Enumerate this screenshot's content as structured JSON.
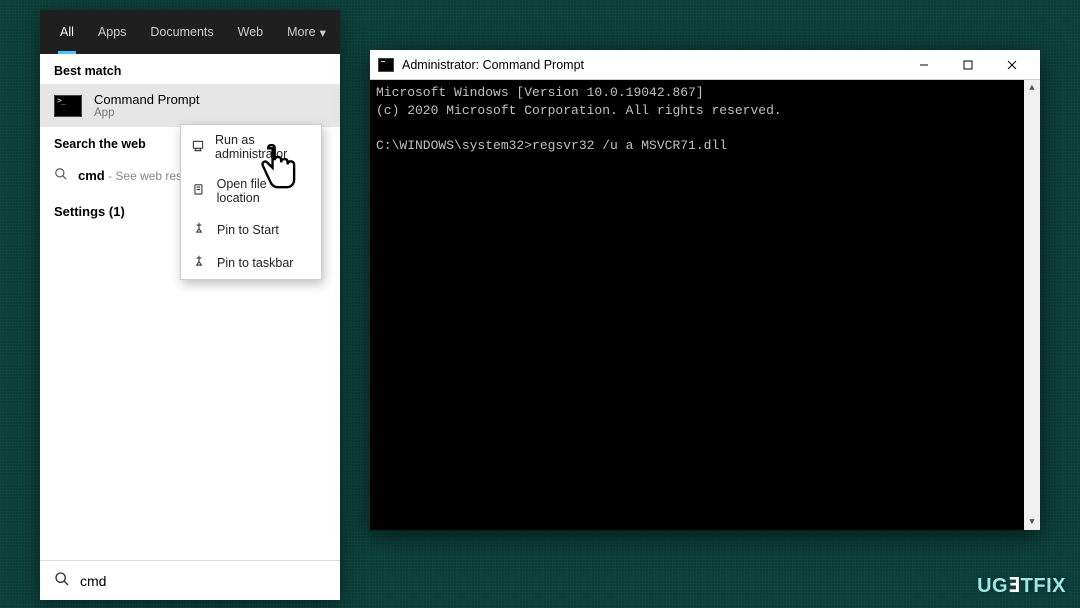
{
  "search": {
    "tabs": {
      "all": "All",
      "apps": "Apps",
      "documents": "Documents",
      "web": "Web",
      "more": "More"
    },
    "best_match_header": "Best match",
    "best_match": {
      "title": "Command Prompt",
      "subtitle": "App"
    },
    "web_header": "Search the web",
    "web_query": "cmd",
    "web_suffix": " - See web results",
    "settings_row": "Settings (1)",
    "input_value": "cmd"
  },
  "context_menu": {
    "run_admin": "Run as administrator",
    "open_file_loc": "Open file location",
    "pin_start": "Pin to Start",
    "pin_taskbar": "Pin to taskbar"
  },
  "cmd": {
    "title": "Administrator: Command Prompt",
    "line1": "Microsoft Windows [Version 10.0.19042.867]",
    "line2": "(c) 2020 Microsoft Corporation. All rights reserved.",
    "blank": "",
    "prompt_prefix": "C:\\WINDOWS\\system32>",
    "prompt_cmd": "regsvr32 /u a MSVCR71.dll"
  },
  "watermark": "UGETFIX"
}
